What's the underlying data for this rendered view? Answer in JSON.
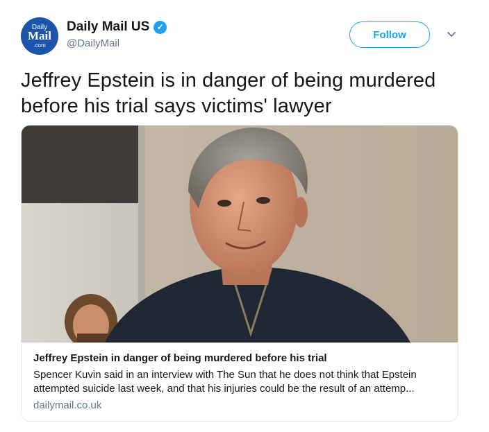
{
  "account": {
    "display_name": "Daily Mail US",
    "handle": "@DailyMail",
    "avatar_text_top": "Daily",
    "avatar_text_main": "Mail",
    "avatar_text_bottom": ".com",
    "verified_icon": "verified-badge-icon",
    "brand_color": "#1b54a8"
  },
  "header": {
    "follow_label": "Follow",
    "menu_icon": "chevron-down-icon",
    "accent_color": "#1da1f2"
  },
  "tweet": {
    "text": "Jeffrey Epstein is in danger of being murdered before his trial says victims' lawyer"
  },
  "card": {
    "title": "Jeffrey Epstein in danger of being murdered before his trial",
    "description": "Spencer Kuvin said in an interview with The Sun that he does not think that Epstein attempted suicide last week, and that his injuries could be the result of an attemp...",
    "domain": "dailymail.co.uk",
    "image": "photo of a smiling gray-haired man in a dark zip jacket"
  }
}
